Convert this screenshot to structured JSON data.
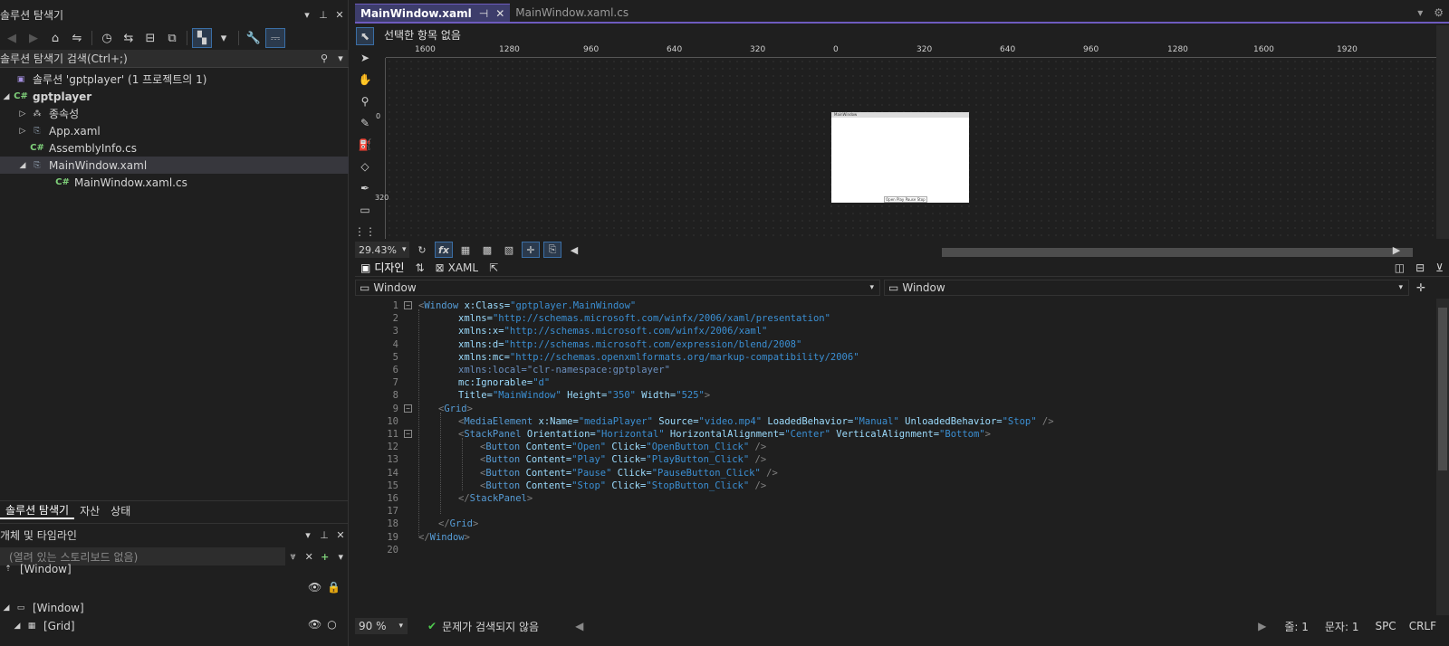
{
  "solution_explorer": {
    "title": "솔루션 탐색기",
    "search_placeholder": "솔루션 탐색기 검색(Ctrl+;)",
    "tree": [
      {
        "label": "솔루션 'gptplayer' (1 프로젝트의 1)",
        "icon": "solution-icon"
      },
      {
        "label": "gptplayer",
        "icon": "csharp-project-icon"
      },
      {
        "label": "종속성",
        "icon": "dependencies-icon"
      },
      {
        "label": "App.xaml",
        "icon": "xaml-file-icon"
      },
      {
        "label": "AssemblyInfo.cs",
        "icon": "csharp-file-icon"
      },
      {
        "label": "MainWindow.xaml",
        "icon": "xaml-file-icon"
      },
      {
        "label": "MainWindow.xaml.cs",
        "icon": "csharp-file-icon"
      }
    ],
    "cs_badge": "C#",
    "bottom_tabs": [
      "솔루션 탐색기",
      "자산",
      "상태"
    ]
  },
  "objects_timeline": {
    "title": "개체 및 타임라인",
    "storyboard_placeholder": "(열려 있는 스토리보드 없음)",
    "root": "[Window]",
    "items": [
      "[Window]",
      "[Grid]"
    ]
  },
  "editor_tabs": [
    "MainWindow.xaml",
    "MainWindow.xaml.cs"
  ],
  "designer": {
    "status_text": "선택한 항목 없음",
    "ruler_top": [
      "1600",
      "1280",
      "960",
      "640",
      "320",
      "0",
      "320",
      "640",
      "960",
      "1280",
      "1600",
      "1920"
    ],
    "ruler_left": [
      "0",
      "320"
    ],
    "zoom": "29.43%",
    "fx_label": "fx",
    "preview_title": "MainWindow",
    "preview_buttons": "Open Play Pause Stop"
  },
  "view_switch": {
    "design": "디자인",
    "xaml": "XAML"
  },
  "nav": {
    "left": "Window",
    "right": "Window"
  },
  "code": {
    "line_numbers": [
      "1",
      "2",
      "3",
      "4",
      "5",
      "6",
      "7",
      "8",
      "9",
      "10",
      "11",
      "12",
      "13",
      "14",
      "15",
      "16",
      "17",
      "18",
      "19",
      "20"
    ],
    "lines": [
      [
        "<",
        "Window",
        " x:Class=",
        "\"gptplayer.MainWindow\""
      ],
      [
        "xmlns=",
        "\"http://schemas.microsoft.com/winfx/2006/xaml/presentation\""
      ],
      [
        "xmlns:x=",
        "\"http://schemas.microsoft.com/winfx/2006/xaml\""
      ],
      [
        "xmlns:d=",
        "\"http://schemas.microsoft.com/expression/blend/2008\""
      ],
      [
        "xmlns:mc=",
        "\"http://schemas.openxmlformats.org/markup-compatibility/2006\""
      ],
      [
        "xmlns:local=",
        "\"clr-namespace:gptplayer\""
      ],
      [
        "mc:Ignorable=",
        "\"d\""
      ],
      [
        "Title=",
        "\"MainWindow\"",
        " Height=",
        "\"350\"",
        " Width=",
        "\"525\"",
        ">"
      ],
      [
        "<",
        "Grid",
        ">"
      ],
      [
        "<",
        "MediaElement",
        " x:Name=",
        "\"mediaPlayer\"",
        " Source=",
        "\"video.mp4\"",
        " LoadedBehavior=",
        "\"Manual\"",
        " UnloadedBehavior=",
        "\"Stop\"",
        " />"
      ],
      [
        "<",
        "StackPanel",
        " Orientation=",
        "\"Horizontal\"",
        " HorizontalAlignment=",
        "\"Center\"",
        " VerticalAlignment=",
        "\"Bottom\"",
        ">"
      ],
      [
        "<",
        "Button",
        " Content=",
        "\"Open\"",
        " Click=",
        "\"OpenButton_Click\"",
        " />"
      ],
      [
        "<",
        "Button",
        " Content=",
        "\"Play\"",
        " Click=",
        "\"PlayButton_Click\"",
        " />"
      ],
      [
        "<",
        "Button",
        " Content=",
        "\"Pause\"",
        " Click=",
        "\"PauseButton_Click\"",
        " />"
      ],
      [
        "<",
        "Button",
        " Content=",
        "\"Stop\"",
        " Click=",
        "\"StopButton_Click\"",
        " />"
      ],
      [
        "</",
        "StackPanel",
        ">"
      ],
      [
        ""
      ],
      [
        "</",
        "Grid",
        ">"
      ],
      [
        "</",
        "Window",
        ">"
      ],
      [
        ""
      ]
    ]
  },
  "editor_status": {
    "zoom": "90 %",
    "issues": "문제가 검색되지 않음",
    "line": "줄: 1",
    "col": "문자: 1",
    "spc": "SPC",
    "eol": "CRLF"
  },
  "colors": {
    "accent": "#6e5bbf",
    "selection": "#37373d",
    "element": "#569cd6",
    "attribute": "#9cdcfe",
    "value": "#ce9178"
  }
}
